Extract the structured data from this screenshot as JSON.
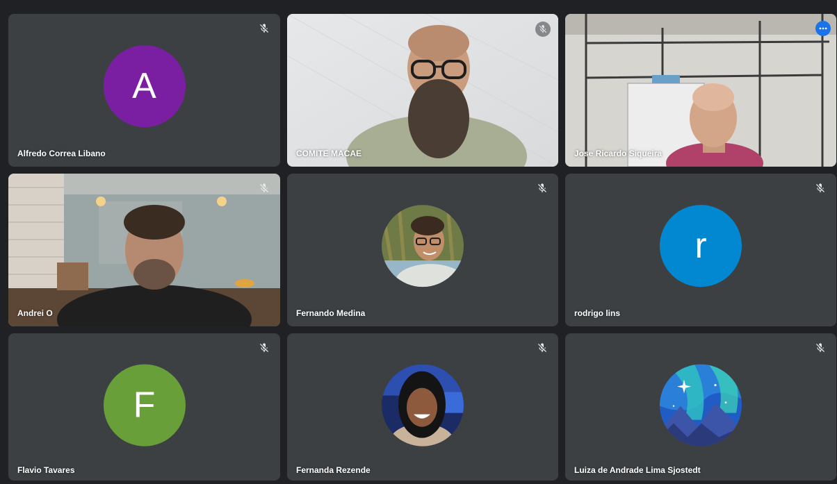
{
  "participants": [
    {
      "name": "Alfredo Correa Libano",
      "initial": "A",
      "avatar_color": "#7b1fa2",
      "muted": true
    },
    {
      "name": "COMITE MACAE",
      "muted": true,
      "video": true
    },
    {
      "name": "Jose Ricardo Siqueira",
      "speaking": true,
      "video": true
    },
    {
      "name": "Andrei O",
      "muted": true,
      "video": true
    },
    {
      "name": "Fernando Medina",
      "muted": true,
      "avatar_photo": true
    },
    {
      "name": "rodrigo lins",
      "initial": "r",
      "avatar_color": "#0288d1",
      "muted": true
    },
    {
      "name": "Flavio Tavares",
      "initial": "F",
      "avatar_color": "#689f38",
      "muted": true
    },
    {
      "name": "Fernanda Rezende",
      "muted": true,
      "avatar_photo": true
    },
    {
      "name": "Luiza de Andrade Lima Sjostedt",
      "muted": true,
      "avatar_photo": true
    }
  ],
  "icons": {
    "muted": "mic-off-icon",
    "options": "more-options-icon"
  },
  "colors": {
    "tile_bg": "#3c4043",
    "page_bg": "#202124",
    "active_border": "#8ab4f8",
    "options_button": "#1a73e8"
  }
}
